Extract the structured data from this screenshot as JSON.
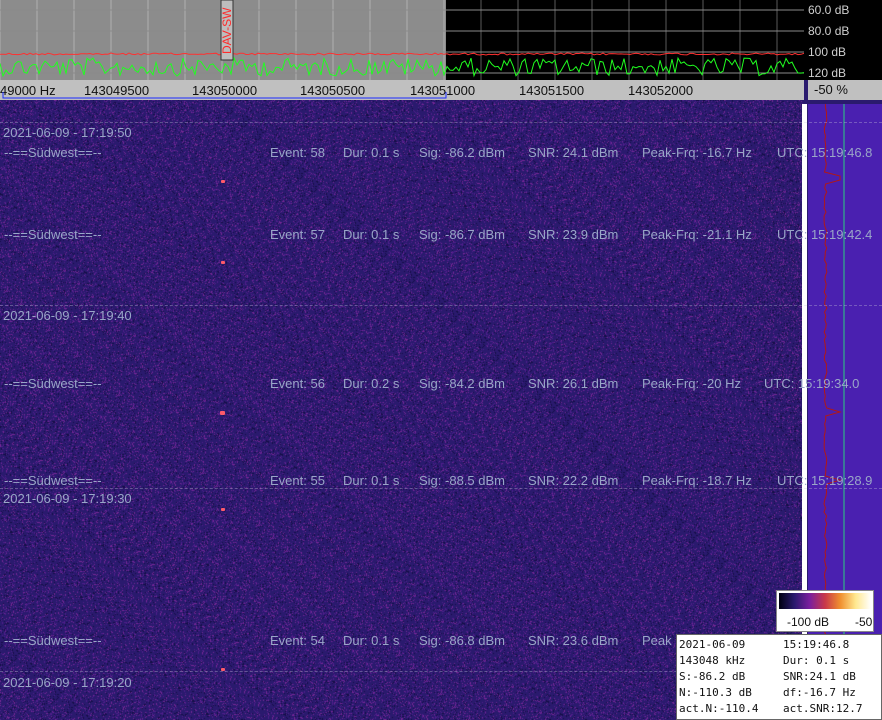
{
  "spectrum": {
    "marker_label": "DAV-SW",
    "db_scale": [
      "60.0 dB",
      "80.0 dB",
      "100 dB",
      "120 dB"
    ]
  },
  "frequency_axis": {
    "labels": [
      "49000 Hz",
      "143049500",
      "143050000",
      "143050500",
      "143051000",
      "143051500",
      "143052000"
    ]
  },
  "zoom_percent": "-50 %",
  "timestamps": [
    "2021-06-09 - 17:19:50",
    "2021-06-09 - 17:19:40",
    "2021-06-09 - 17:19:30",
    "2021-06-09 - 17:19:20"
  ],
  "events": [
    {
      "station": "--==Südwest==--",
      "event": "Event: 58",
      "dur": "Dur: 0.1 s",
      "sig": "Sig: -86.2 dBm",
      "snr": "SNR: 24.1 dBm",
      "peak": "Peak-Frq: -16.7 Hz",
      "utc": "UTC: 15:19:46.8"
    },
    {
      "station": "--==Südwest==--",
      "event": "Event: 57",
      "dur": "Dur: 0.1 s",
      "sig": "Sig: -86.7 dBm",
      "snr": "SNR: 23.9 dBm",
      "peak": "Peak-Frq: -21.1 Hz",
      "utc": "UTC: 15:19:42.4"
    },
    {
      "station": "--==Südwest==--",
      "event": "Event: 56",
      "dur": "Dur: 0.2 s",
      "sig": "Sig: -84.2 dBm",
      "snr": "SNR: 26.1 dBm",
      "peak": "Peak-Frq: -20 Hz",
      "utc": "UTC: 15:19:34.0"
    },
    {
      "station": "--==Südwest==--",
      "event": "Event: 55",
      "dur": "Dur: 0.1 s",
      "sig": "Sig: -88.5 dBm",
      "snr": "SNR: 22.2 dBm",
      "peak": "Peak-Frq: -18.7 Hz",
      "utc": "UTC: 15:19:28.9"
    },
    {
      "station": "--==Südwest==--",
      "event": "Event: 54",
      "dur": "Dur: 0.1 s",
      "sig": "Sig: -86.8 dBm",
      "snr": "SNR: 23.6 dBm",
      "peak": "Peak",
      "utc": ""
    }
  ],
  "legend": {
    "min": "-100 dB",
    "max": "-50"
  },
  "info": {
    "date": "2021-06-09",
    "time": "15:19:46.8",
    "freq": "143048 kHz",
    "dur": "Dur: 0.1 s",
    "s": "S:-86.2 dB",
    "snr": "SNR:24.1 dB",
    "n": "N:-110.3 dB",
    "df": "df:-16.7 Hz",
    "act_n": "act.N:-110.4",
    "act_snr": "act.SNR:12.7"
  },
  "colors": {
    "background": "#2a1a6e",
    "signal": "#00ff00",
    "peak_line": "#ff3030",
    "text": "#9aa6c8"
  }
}
